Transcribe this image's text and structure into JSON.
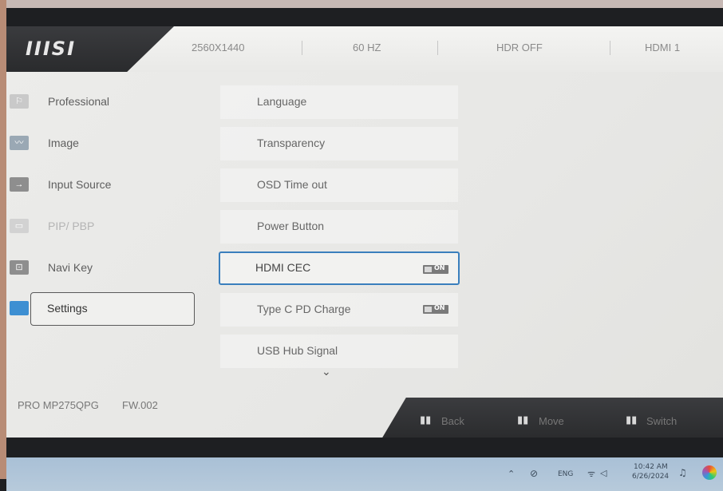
{
  "header": {
    "logo": "IIISI",
    "resolution": "2560X1440",
    "refresh": "60 HZ",
    "hdr": "HDR  OFF",
    "input": "HDMI 1"
  },
  "menu": {
    "items": [
      {
        "label": "Professional",
        "icon": "professional-icon"
      },
      {
        "label": "Image",
        "icon": "image-icon"
      },
      {
        "label": "Input Source",
        "icon": "arrow-right-icon"
      },
      {
        "label": "PIP/ PBP",
        "icon": "pip-icon"
      },
      {
        "label": "Navi Key",
        "icon": "navi-key-icon"
      },
      {
        "label": "Settings",
        "icon": "settings-icon"
      }
    ]
  },
  "settings": {
    "rows": [
      {
        "label": "Language"
      },
      {
        "label": "Transparency"
      },
      {
        "label": "OSD Time out"
      },
      {
        "label": "Power Button"
      },
      {
        "label": "HDMI CEC",
        "toggle": "ON"
      },
      {
        "label": "Type C PD Charge",
        "toggle": "ON"
      },
      {
        "label": "USB Hub Signal"
      }
    ],
    "more_icon": "chevron-down-icon"
  },
  "footer": {
    "model": "PRO MP275QPG",
    "firmware": "FW.002"
  },
  "nav": {
    "back": "Back",
    "move": "Move",
    "switch": "Switch"
  },
  "taskbar": {
    "lang": "ENG",
    "time": "10:42 AM",
    "date": "6/26/2024"
  },
  "colors": {
    "accent": "#3a7fbd",
    "selected_icon": "#3d8fd2"
  }
}
